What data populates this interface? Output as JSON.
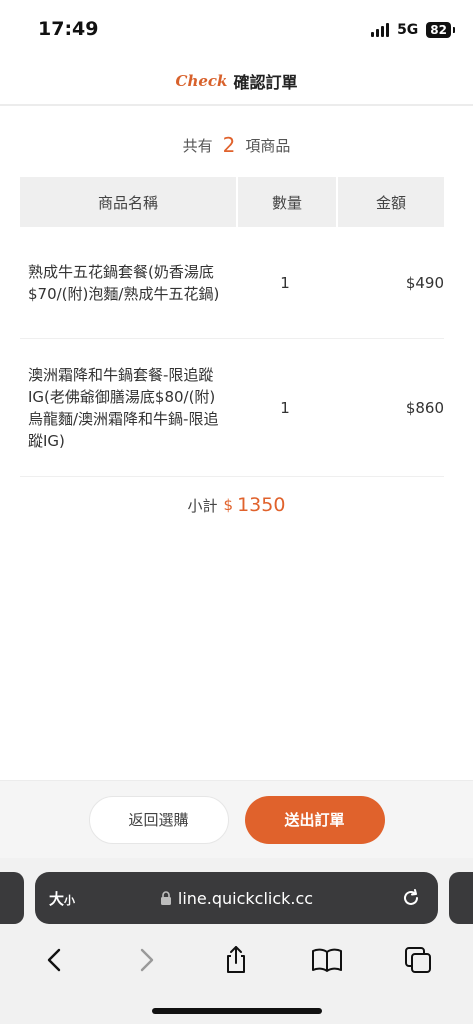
{
  "status": {
    "time": "17:49",
    "network": "5G",
    "battery": "82"
  },
  "header": {
    "brand": "Check",
    "title": "確認訂單"
  },
  "summary": {
    "prefix": "共有",
    "count": "2",
    "suffix": "項商品"
  },
  "table": {
    "headers": [
      "商品名稱",
      "數量",
      "金額"
    ],
    "rows": [
      {
        "name": "熟成牛五花鍋套餐(奶香湯底 $70/(附)泡麵/熟成牛五花鍋)",
        "qty": "1",
        "amount": "$490"
      },
      {
        "name": "澳洲霜降和牛鍋套餐-限追蹤IG(老佛爺御膳湯底$80/(附)烏龍麵/澳洲霜降和牛鍋-限追蹤IG)",
        "qty": "1",
        "amount": "$860"
      }
    ]
  },
  "subtotal": {
    "label": "小計",
    "currency": "$",
    "value": "1350"
  },
  "actions": {
    "back_label": "返回選購",
    "submit_label": "送出訂單"
  },
  "browser": {
    "text_size_big": "大",
    "text_size_small": "小",
    "url": "line.quickclick.cc"
  },
  "colors": {
    "accent": "#e0622c"
  }
}
